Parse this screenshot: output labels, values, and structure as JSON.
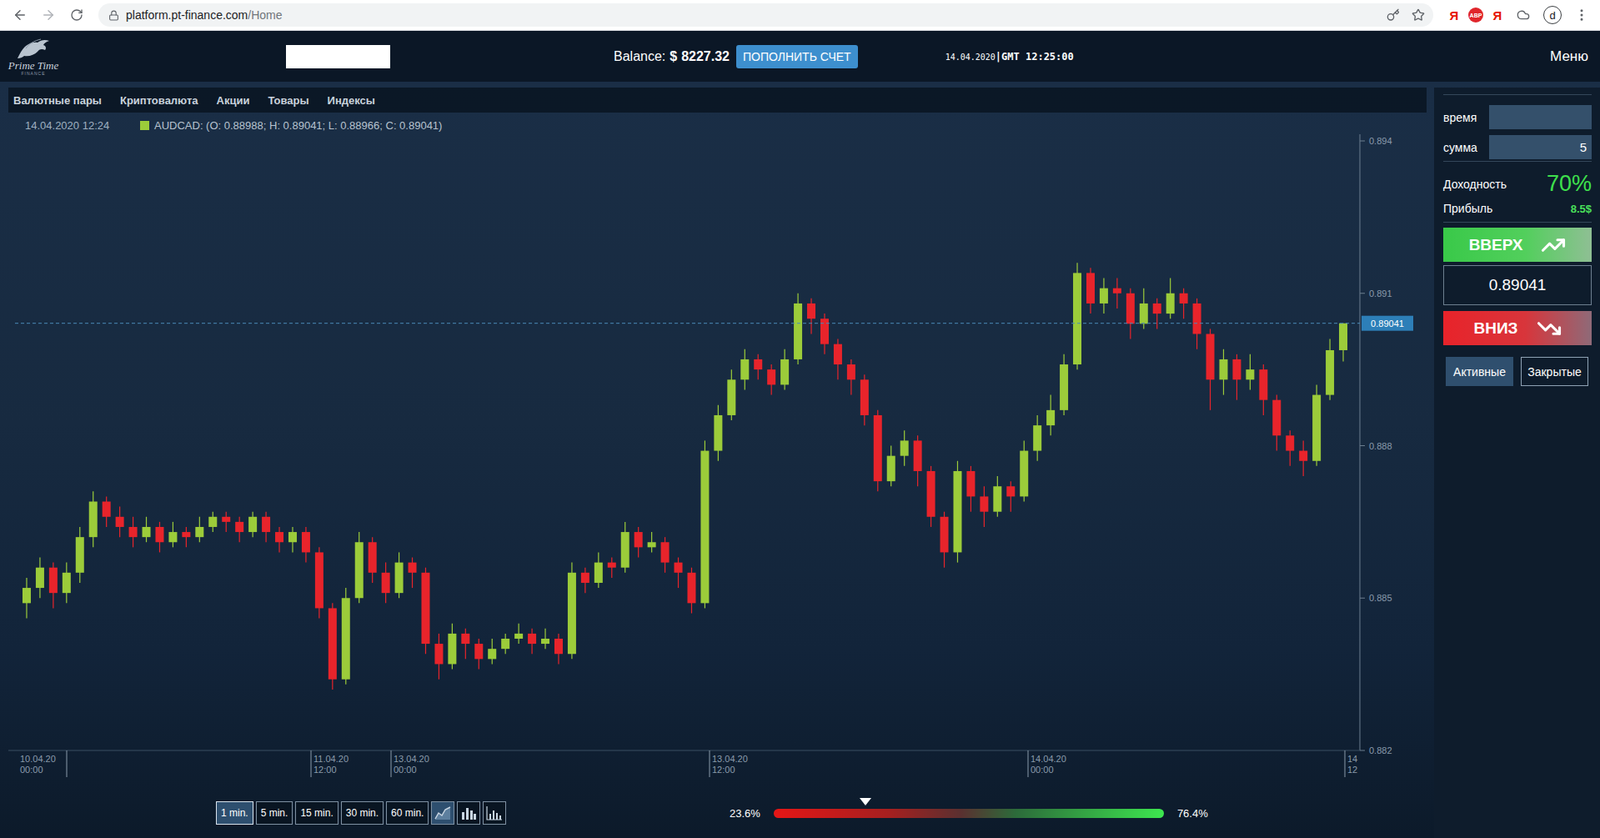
{
  "browser": {
    "url_host": "platform.pt-finance.com",
    "url_path": "/Home",
    "extensions": [
      {
        "label": "Я",
        "kind": "letter"
      },
      {
        "label": "ABP",
        "kind": "badge"
      },
      {
        "label": "Я",
        "kind": "letter"
      }
    ],
    "avatar": "d"
  },
  "header": {
    "logo_title": "Prime Time",
    "logo_subtitle": "FINANCE",
    "account_field": "",
    "balance_label": "Balance:",
    "balance_currency": "$",
    "balance_value": "8227.32",
    "deposit_button": "ПОПОЛНИТЬ СЧЕТ",
    "date": "14.04.2020",
    "time": "|GMT 12:25:00",
    "menu": "Меню"
  },
  "markets": [
    {
      "label": "Валютные пары",
      "selected": false
    },
    {
      "label": "Криптовалюта",
      "selected": false
    },
    {
      "label": "Акции",
      "selected": false
    },
    {
      "label": "Товары",
      "selected": false
    },
    {
      "label": "Индексы",
      "selected": false
    }
  ],
  "chart": {
    "timestamp": "14.04.2020 12:24",
    "legend": "AUDCAD: (O: 0.88988; H: 0.89041; L: 0.88966; C: 0.89041)",
    "y_ticks": [
      "0.894",
      "0.891",
      "0.888",
      "0.885",
      "0.882"
    ],
    "current_price": "0.89041",
    "x_ticks": [
      {
        "date": "10.04.20",
        "time": "00:00"
      },
      {
        "date": "11.04.20",
        "time": "12:00"
      },
      {
        "date": "13.04.20",
        "time": "00:00"
      },
      {
        "date": "13.04.20",
        "time": "12:00"
      },
      {
        "date": "14.04.20",
        "time": "00:00"
      },
      {
        "date": "14",
        "time": "12"
      }
    ],
    "candles": [
      [
        0.8849,
        0.8854,
        0.8846,
        0.8852
      ],
      [
        0.8852,
        0.8858,
        0.885,
        0.8856
      ],
      [
        0.8856,
        0.8857,
        0.8848,
        0.8851
      ],
      [
        0.8851,
        0.8857,
        0.8849,
        0.8855
      ],
      [
        0.8855,
        0.8864,
        0.8853,
        0.8862
      ],
      [
        0.8862,
        0.8871,
        0.886,
        0.8869
      ],
      [
        0.8869,
        0.887,
        0.8864,
        0.8866
      ],
      [
        0.8866,
        0.8868,
        0.8862,
        0.8864
      ],
      [
        0.8864,
        0.8866,
        0.886,
        0.8862
      ],
      [
        0.8862,
        0.8866,
        0.8861,
        0.8864
      ],
      [
        0.8864,
        0.8865,
        0.8859,
        0.8861
      ],
      [
        0.8861,
        0.8865,
        0.886,
        0.8863
      ],
      [
        0.8863,
        0.8864,
        0.886,
        0.8862
      ],
      [
        0.8862,
        0.8866,
        0.8861,
        0.8864
      ],
      [
        0.8864,
        0.8867,
        0.8863,
        0.8866
      ],
      [
        0.8866,
        0.8867,
        0.8863,
        0.8865
      ],
      [
        0.8865,
        0.8866,
        0.8861,
        0.8863
      ],
      [
        0.8863,
        0.8867,
        0.8862,
        0.8866
      ],
      [
        0.8866,
        0.8867,
        0.8861,
        0.8863
      ],
      [
        0.8863,
        0.8864,
        0.8859,
        0.8861
      ],
      [
        0.8861,
        0.8864,
        0.8859,
        0.8863
      ],
      [
        0.8863,
        0.8864,
        0.8857,
        0.8859
      ],
      [
        0.8859,
        0.886,
        0.8846,
        0.8848
      ],
      [
        0.8848,
        0.8849,
        0.8832,
        0.8834
      ],
      [
        0.8834,
        0.8852,
        0.8833,
        0.885
      ],
      [
        0.885,
        0.8863,
        0.8849,
        0.8861
      ],
      [
        0.8861,
        0.8862,
        0.8853,
        0.8855
      ],
      [
        0.8855,
        0.8857,
        0.8849,
        0.8851
      ],
      [
        0.8851,
        0.8859,
        0.885,
        0.8857
      ],
      [
        0.8857,
        0.8858,
        0.8852,
        0.8855
      ],
      [
        0.8855,
        0.8856,
        0.8839,
        0.8841
      ],
      [
        0.8841,
        0.8843,
        0.8834,
        0.8837
      ],
      [
        0.8837,
        0.8845,
        0.8836,
        0.8843
      ],
      [
        0.8843,
        0.8844,
        0.8838,
        0.8841
      ],
      [
        0.8841,
        0.8842,
        0.8836,
        0.8838
      ],
      [
        0.8838,
        0.8842,
        0.8837,
        0.884
      ],
      [
        0.884,
        0.8843,
        0.8839,
        0.8842
      ],
      [
        0.8842,
        0.8845,
        0.8841,
        0.8843
      ],
      [
        0.8843,
        0.8844,
        0.8839,
        0.8841
      ],
      [
        0.8841,
        0.8844,
        0.884,
        0.8842
      ],
      [
        0.8842,
        0.8843,
        0.8837,
        0.8839
      ],
      [
        0.8839,
        0.8857,
        0.8838,
        0.8855
      ],
      [
        0.8855,
        0.8856,
        0.8851,
        0.8853
      ],
      [
        0.8853,
        0.8859,
        0.8852,
        0.8857
      ],
      [
        0.8857,
        0.8858,
        0.8854,
        0.8856
      ],
      [
        0.8856,
        0.8865,
        0.8855,
        0.8863
      ],
      [
        0.8863,
        0.8864,
        0.8858,
        0.886
      ],
      [
        0.886,
        0.8863,
        0.8859,
        0.8861
      ],
      [
        0.8861,
        0.8862,
        0.8855,
        0.8857
      ],
      [
        0.8857,
        0.8858,
        0.8852,
        0.8855
      ],
      [
        0.8855,
        0.8856,
        0.8847,
        0.8849
      ],
      [
        0.8849,
        0.8881,
        0.8848,
        0.8879
      ],
      [
        0.8879,
        0.8888,
        0.8877,
        0.8886
      ],
      [
        0.8886,
        0.8895,
        0.8885,
        0.8893
      ],
      [
        0.8893,
        0.8899,
        0.8891,
        0.8897
      ],
      [
        0.8897,
        0.8898,
        0.8893,
        0.8895
      ],
      [
        0.8895,
        0.8896,
        0.889,
        0.8892
      ],
      [
        0.8892,
        0.8899,
        0.8891,
        0.8897
      ],
      [
        0.8897,
        0.891,
        0.8896,
        0.8908
      ],
      [
        0.8908,
        0.8909,
        0.8902,
        0.8905
      ],
      [
        0.8905,
        0.8906,
        0.8898,
        0.89
      ],
      [
        0.89,
        0.8901,
        0.8893,
        0.8896
      ],
      [
        0.8896,
        0.8897,
        0.889,
        0.8893
      ],
      [
        0.8893,
        0.8894,
        0.8884,
        0.8886
      ],
      [
        0.8886,
        0.8887,
        0.8871,
        0.8873
      ],
      [
        0.8873,
        0.888,
        0.8872,
        0.8878
      ],
      [
        0.8878,
        0.8883,
        0.8876,
        0.8881
      ],
      [
        0.8881,
        0.8882,
        0.8872,
        0.8875
      ],
      [
        0.8875,
        0.8876,
        0.8864,
        0.8866
      ],
      [
        0.8866,
        0.8867,
        0.8856,
        0.8859
      ],
      [
        0.8859,
        0.8877,
        0.8857,
        0.8875
      ],
      [
        0.8875,
        0.8876,
        0.8867,
        0.887
      ],
      [
        0.887,
        0.8872,
        0.8864,
        0.8867
      ],
      [
        0.8867,
        0.8874,
        0.8866,
        0.8872
      ],
      [
        0.8872,
        0.8873,
        0.8867,
        0.887
      ],
      [
        0.887,
        0.8881,
        0.8869,
        0.8879
      ],
      [
        0.8879,
        0.8886,
        0.8877,
        0.8884
      ],
      [
        0.8884,
        0.889,
        0.8882,
        0.8887
      ],
      [
        0.8887,
        0.8898,
        0.8886,
        0.8896
      ],
      [
        0.8896,
        0.8916,
        0.8895,
        0.8914
      ],
      [
        0.8914,
        0.8915,
        0.8906,
        0.8908
      ],
      [
        0.8908,
        0.8913,
        0.8906,
        0.8911
      ],
      [
        0.8911,
        0.8913,
        0.8907,
        0.891
      ],
      [
        0.891,
        0.8911,
        0.8901,
        0.8904
      ],
      [
        0.8904,
        0.8911,
        0.8903,
        0.8908
      ],
      [
        0.8908,
        0.8909,
        0.8903,
        0.8906
      ],
      [
        0.8906,
        0.8913,
        0.8905,
        0.891
      ],
      [
        0.891,
        0.8911,
        0.8905,
        0.8908
      ],
      [
        0.8908,
        0.8909,
        0.8899,
        0.8902
      ],
      [
        0.8902,
        0.8903,
        0.8887,
        0.8893
      ],
      [
        0.8893,
        0.8899,
        0.889,
        0.8897
      ],
      [
        0.8897,
        0.8898,
        0.8889,
        0.8893
      ],
      [
        0.8893,
        0.8898,
        0.8891,
        0.8895
      ],
      [
        0.8895,
        0.8896,
        0.8886,
        0.8889
      ],
      [
        0.8889,
        0.889,
        0.8879,
        0.8882
      ],
      [
        0.8882,
        0.8883,
        0.8876,
        0.8879
      ],
      [
        0.8879,
        0.8881,
        0.8874,
        0.8877
      ],
      [
        0.8877,
        0.8892,
        0.8876,
        0.889
      ],
      [
        0.889,
        0.8901,
        0.8889,
        0.88988
      ],
      [
        0.88988,
        0.89041,
        0.88966,
        0.89041
      ]
    ]
  },
  "timeframes": [
    {
      "label": "1 min.",
      "selected": true
    },
    {
      "label": "5 min.",
      "selected": false
    },
    {
      "label": "15 min.",
      "selected": false
    },
    {
      "label": "30 min.",
      "selected": false
    },
    {
      "label": "60 min.",
      "selected": false
    }
  ],
  "chart_types": [
    {
      "kind": "area",
      "selected": true
    },
    {
      "kind": "bars",
      "selected": false
    },
    {
      "kind": "histogram",
      "selected": false
    }
  ],
  "sentiment": {
    "down": "23.6%",
    "up": "76.4%",
    "level": 0.236
  },
  "trade": {
    "time_label": "время",
    "time_value": "",
    "amount_label": "сумма",
    "amount_value": "5",
    "yield_label": "Доходность",
    "yield_value": "70%",
    "profit_label": "Прибыль",
    "profit_value": "8.5$",
    "up_button": "ВВЕРХ",
    "price": "0.89041",
    "down_button": "ВНИЗ"
  },
  "deals_tabs": [
    {
      "label": "Активные",
      "selected": true
    },
    {
      "label": "Закрытые",
      "selected": false
    }
  ]
}
